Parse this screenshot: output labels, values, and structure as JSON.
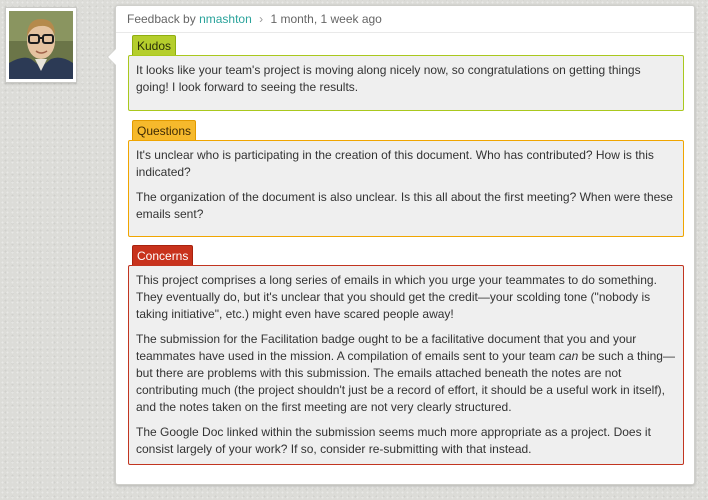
{
  "header": {
    "prefix": "Feedback by",
    "author": "nmashton",
    "separator": "›",
    "time": "1 month, 1 week ago"
  },
  "sections": {
    "kudos": {
      "label": "Kudos",
      "paragraphs": [
        "It looks like your team's project is moving along nicely now, so congratulations on getting things going! I look forward to seeing the results."
      ]
    },
    "questions": {
      "label": "Questions",
      "paragraphs": [
        "It's unclear who is participating in the creation of this document. Who has contributed? How is this indicated?",
        "The organization of the document is also unclear. Is this all about the first meeting? When were these emails sent?"
      ]
    },
    "concerns": {
      "label": "Concerns",
      "paragraphs": [
        "This project comprises a long series of emails in which you urge your teammates to do something. They eventually do, but it's unclear that you should get the credit—your scolding tone (\"nobody is taking initiative\", etc.) might even have scared people away!",
        {
          "before": "The submission for the Facilitation badge ought to be a facilitative document that you and your teammates have used in the mission. A compilation of emails sent to your team ",
          "emphasis": "can",
          "after": " be such a thing—but there are problems with this submission. The emails attached beneath the notes are not contributing much (the project shouldn't just be a record of effort, it should be a useful work in itself), and the notes taken on the first meeting are not very clearly structured."
        },
        "The Google Doc linked within the submission seems much more appropriate as a project. Does it consist largely of your work? If so, consider re-submitting with that instead."
      ]
    }
  },
  "colors": {
    "author_link": "#2aa39b",
    "kudos": "#b5ce2c",
    "questions": "#f6b92c",
    "concerns": "#c8321c"
  },
  "icons": {
    "avatar": "user-avatar-photo"
  }
}
